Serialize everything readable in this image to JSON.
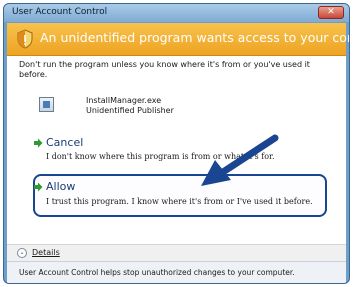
{
  "window": {
    "title": "User Account Control",
    "close_glyph": "✕"
  },
  "banner": {
    "heading": "An unidentified program wants access to your computer",
    "icon": "shield-icon",
    "color": "#eea323"
  },
  "content": {
    "warning": "Don't run the program unless you know where it's from or you've used it before.",
    "program": {
      "name": "InstallManager.exe",
      "publisher": "Unidentified Publisher"
    },
    "options": [
      {
        "label": "Cancel",
        "description": "I don't know where this program is from or what it's for."
      },
      {
        "label": "Allow",
        "description": "I trust this program. I know where it's from or I've used it before."
      }
    ]
  },
  "details": {
    "label": "Details",
    "toggle_glyph": "⌄"
  },
  "footer": {
    "text": "User Account Control helps stop unauthorized changes to your computer."
  },
  "colors": {
    "accent_arrow": "#1a4590",
    "option_green": "#2f9a2f"
  }
}
